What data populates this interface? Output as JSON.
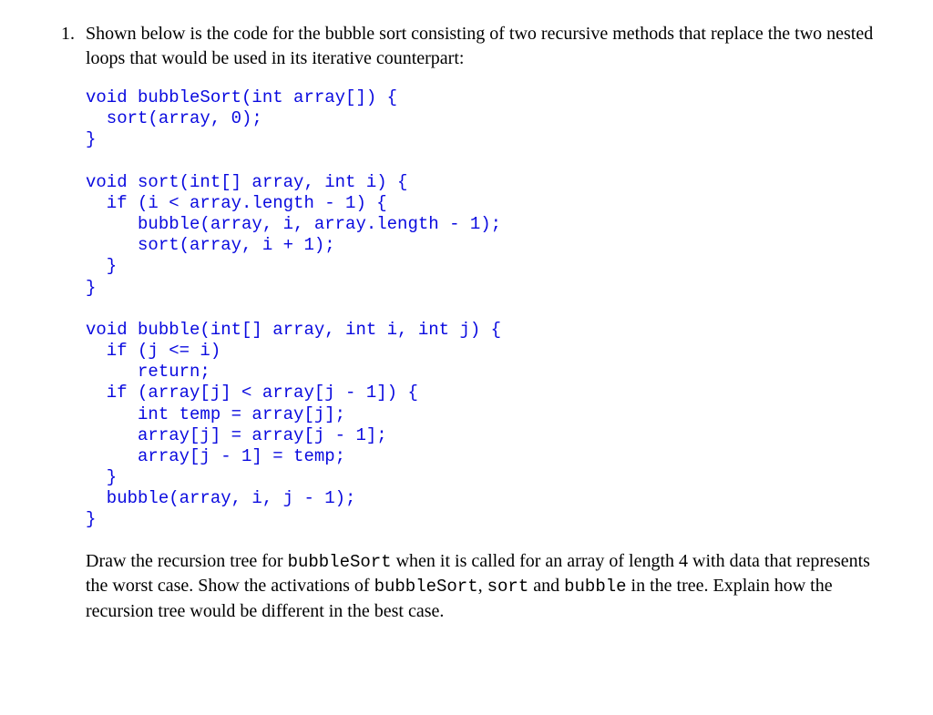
{
  "item": {
    "marker": "1.",
    "intro": "Shown below is the code for the bubble sort consisting of two recursive methods that replace the two nested loops that would be used in its iterative counterpart:",
    "code": "void bubbleSort(int array[]) {\n  sort(array, 0);\n}\n\nvoid sort(int[] array, int i) {\n  if (i < array.length - 1) {\n     bubble(array, i, array.length - 1);\n     sort(array, i + 1);\n  }\n}\n\nvoid bubble(int[] array, int i, int j) {\n  if (j <= i)\n     return;\n  if (array[j] < array[j - 1]) {\n     int temp = array[j];\n     array[j] = array[j - 1];\n     array[j - 1] = temp;\n  }\n  bubble(array, i, j - 1);\n}",
    "outro_pre1": "Draw the recursion tree for ",
    "outro_code1": "bubbleSort",
    "outro_mid1": " when it is called for an array of length 4 with data that represents the worst case. Show the activations of ",
    "outro_code2": "bubbleSort",
    "outro_sep1": ", ",
    "outro_code3": "sort",
    "outro_sep2": " and ",
    "outro_code4": "bubble",
    "outro_post": " in the tree. Explain how the recursion tree would be different in the best case."
  }
}
